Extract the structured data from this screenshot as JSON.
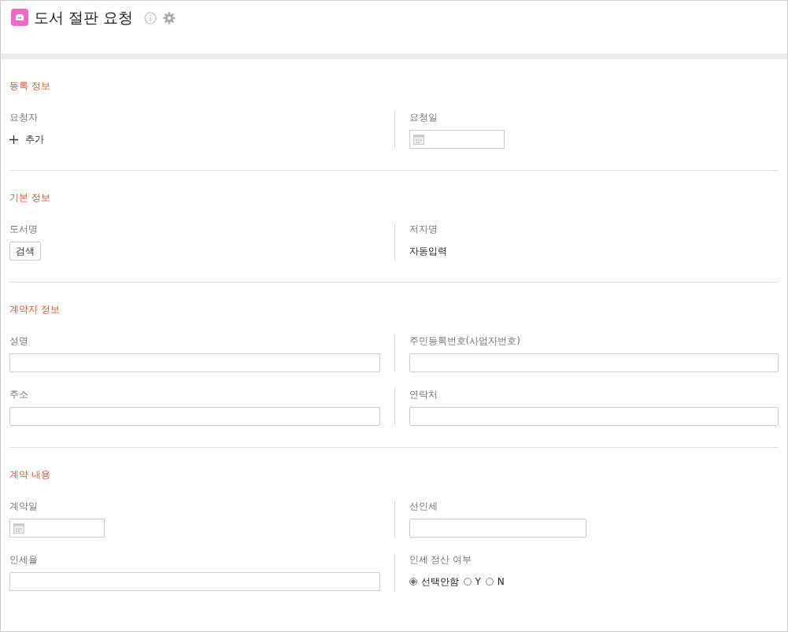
{
  "header": {
    "title": "도서 절판 요청"
  },
  "sections": [
    {
      "title": "등록 정보",
      "rows": [
        [
          {
            "label": "요청자",
            "kind": "add",
            "action": "추가"
          },
          {
            "label": "요청일",
            "kind": "date"
          }
        ]
      ]
    },
    {
      "title": "기본 정보",
      "rows": [
        [
          {
            "label": "도서명",
            "kind": "button",
            "button": "검색"
          },
          {
            "label": "저자명",
            "kind": "text",
            "value": "자동입력"
          }
        ]
      ]
    },
    {
      "title": "계약자 정보",
      "rows": [
        [
          {
            "label": "성명",
            "kind": "input"
          },
          {
            "label": "주민등록번호(사업자번호)",
            "kind": "input"
          }
        ],
        [
          {
            "label": "주소",
            "kind": "input"
          },
          {
            "label": "연락처",
            "kind": "input"
          }
        ]
      ]
    },
    {
      "title": "계약 내용",
      "rows": [
        [
          {
            "label": "계약일",
            "kind": "date"
          },
          {
            "label": "선인세",
            "kind": "short-input"
          }
        ],
        [
          {
            "label": "인세율",
            "kind": "input"
          },
          {
            "label": "인세 정산 여부",
            "kind": "radio",
            "options": [
              {
                "label": "선택안함",
                "selected": true
              },
              {
                "label": "Y",
                "selected": false
              },
              {
                "label": "N",
                "selected": false
              }
            ]
          }
        ]
      ]
    }
  ]
}
